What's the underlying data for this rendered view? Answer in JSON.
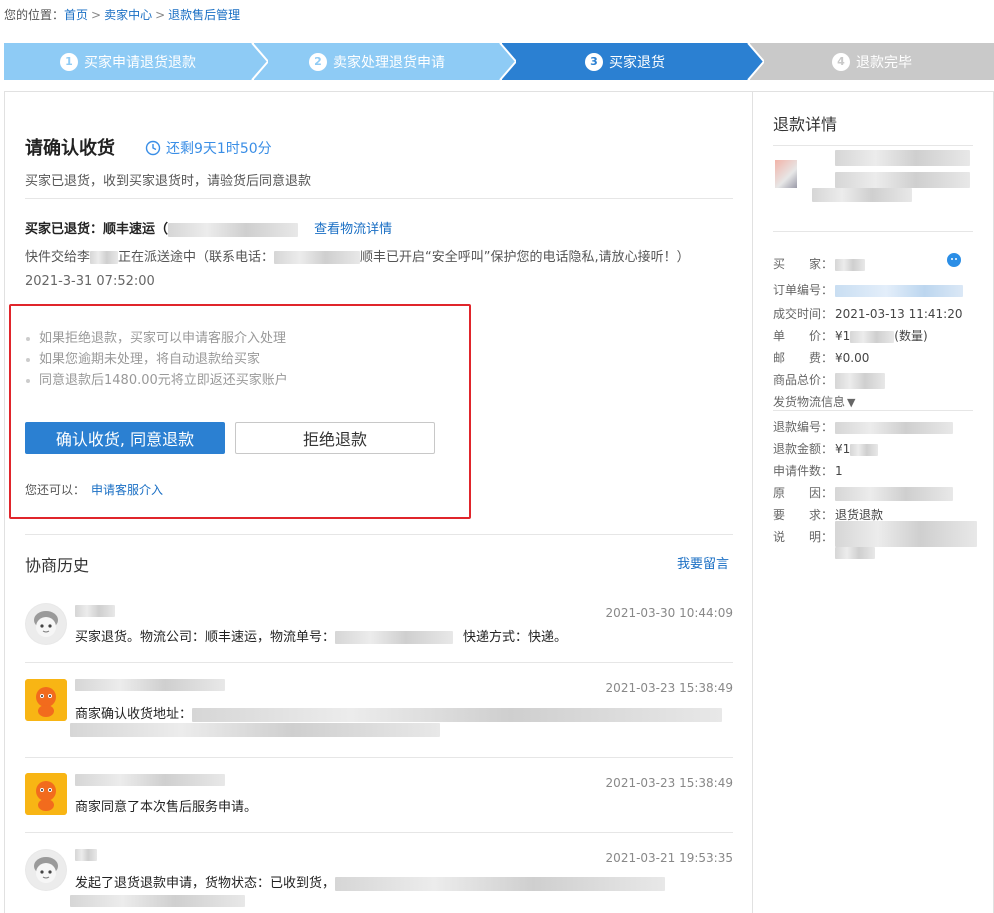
{
  "breadcrumb": {
    "prefix": "您的位置：",
    "items": [
      "首页",
      "卖家中心",
      "退款售后管理"
    ],
    "sep": ">"
  },
  "steps": [
    {
      "num": "1",
      "label": "买家申请退货退款",
      "state": "done"
    },
    {
      "num": "2",
      "label": "卖家处理退货申请",
      "state": "done"
    },
    {
      "num": "3",
      "label": "买家退货",
      "state": "active"
    },
    {
      "num": "4",
      "label": "退款完毕",
      "state": "pending"
    }
  ],
  "colors": {
    "done": "#8ecbf5",
    "active": "#2b80d2",
    "pending": "#c9c9c9",
    "link": "#1a6fc4",
    "highlight": "#e0252b"
  },
  "main": {
    "title": "请确认收货",
    "timer": "还剩9天1时50分",
    "subtitle": "买家已退货，收到买家退货时，请验货后同意退款",
    "shipping_prefix": "买家已退货：顺丰速运（",
    "logistics_link": "查看物流详情",
    "deliver_prefix": "快件交给李",
    "deliver_mid": "正在派送途中（联系电话：",
    "deliver_suffix": "顺丰已开启“安全呼叫”保护您的电话隐私,请放心接听！）",
    "deliver_time": "2021-3-31 07:52:00",
    "tips": [
      "如果拒绝退款，买家可以申请客服介入处理",
      "如果您逾期未处理，将自动退款给买家",
      "同意退款后1480.00元将立即返还买家账户"
    ],
    "confirm_button": "确认收货, 同意退款",
    "reject_button": "拒绝退款",
    "also_label": "您还可以：",
    "also_link": "申请客服介入"
  },
  "history": {
    "title": "协商历史",
    "leave_message": "我要留言",
    "items": [
      {
        "time": "2021-03-30 10:44:09",
        "text_a": "买家退货。物流公司：顺丰速运，物流单号：",
        "text_b": "快递方式：快递。",
        "avatar": "buyer"
      },
      {
        "time": "2021-03-23 15:38:49",
        "text_a": "商家确认收货地址：",
        "text_b": "",
        "avatar": "seller"
      },
      {
        "time": "2021-03-23 15:38:49",
        "text_a": "商家同意了本次售后服务申请。",
        "text_b": "",
        "avatar": "seller"
      },
      {
        "time": "2021-03-21 19:53:35",
        "text_a": "发起了退货退款申请，货物状态：已收到货，",
        "text_b": "",
        "avatar": "buyer"
      }
    ]
  },
  "sidebar": {
    "title": "退款详情",
    "rows": [
      {
        "k": "买　　家：",
        "v": ""
      },
      {
        "k": "订单编号：",
        "v": ""
      },
      {
        "k": "成交时间：",
        "v": "2021-03-13 11:41:20"
      },
      {
        "k": "单　　价：",
        "v": "¥1",
        "v2": "(数量)"
      },
      {
        "k": "邮　　费：",
        "v": "¥0.00"
      },
      {
        "k": "商品总价：",
        "v": ""
      },
      {
        "k": "发货物流信息",
        "v": ""
      },
      {
        "k": "退款编号：",
        "v": ""
      },
      {
        "k": "退款金额：",
        "v": "¥1"
      },
      {
        "k": "申请件数：",
        "v": "1"
      },
      {
        "k": "原　　因：",
        "v": ""
      },
      {
        "k": "要　　求：",
        "v": "退货退款"
      },
      {
        "k": "说　　明：",
        "v": ""
      }
    ]
  }
}
